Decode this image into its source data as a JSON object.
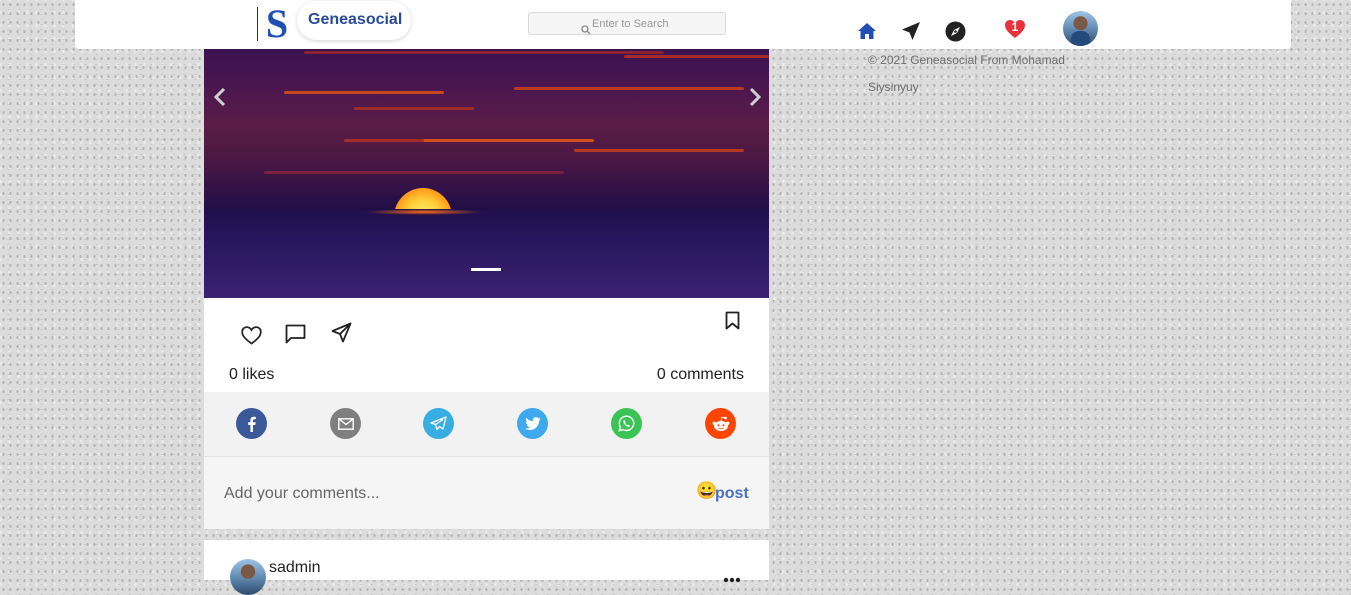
{
  "header": {
    "brand_name": "Geneasocial",
    "logo_letter": "S",
    "search_placeholder": "Enter to Search",
    "notification_count": "1",
    "icons": [
      "home-icon",
      "send-icon",
      "compass-icon",
      "heart-icon",
      "avatar"
    ],
    "accent_color": "#1f4fb3"
  },
  "footer": {
    "copyright": "© 2021 Geneasocial From Mohamad Siysinyuy"
  },
  "post": {
    "likes_text": "0 likes",
    "comments_text": "0 comments",
    "share_targets": [
      "facebook",
      "email",
      "telegram",
      "twitter",
      "whatsapp",
      "reddit"
    ],
    "share_colors": {
      "facebook": "#3b5998",
      "email": "#7f7f7f",
      "telegram": "#37aee2",
      "twitter": "#3fa9f0",
      "whatsapp": "#3bc455",
      "reddit": "#ff4500"
    },
    "comment_placeholder": "Add your comments...",
    "emoji": "😀",
    "post_button": "post"
  },
  "next_post": {
    "username": "sadmin"
  }
}
